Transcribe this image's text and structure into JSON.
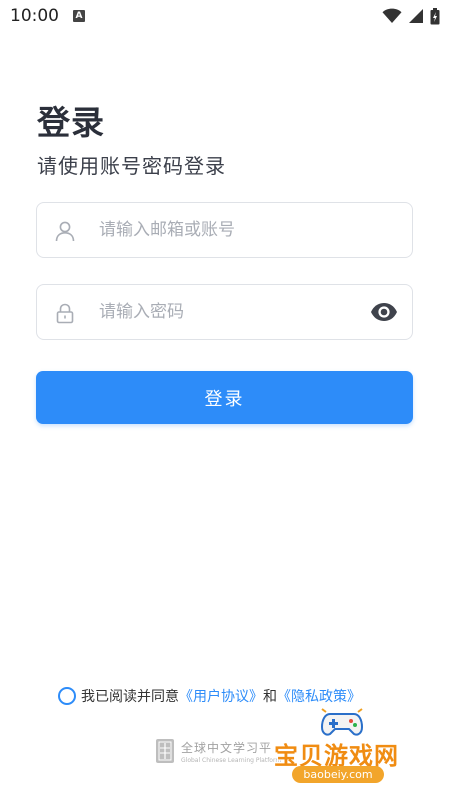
{
  "status_bar": {
    "time": "10:00",
    "notification_letter": "A"
  },
  "header": {
    "title": "登录",
    "subtitle": "请使用账号密码登录"
  },
  "form": {
    "email_placeholder": "请输入邮箱或账号",
    "email_value": "",
    "password_placeholder": "请输入密码",
    "password_value": "",
    "login_label": "登录"
  },
  "agreement": {
    "prefix": "我已阅读并同意",
    "user_agreement": "《用户协议》",
    "and": "和",
    "privacy_policy": "《隐私政策》",
    "checked": false
  },
  "brand": {
    "name_cn": "全球中文学习平",
    "name_en": "Global Chinese Learning Platform"
  },
  "watermark": {
    "name_cn": "宝贝游戏网",
    "url": "baobeiy.com"
  },
  "colors": {
    "primary": "#2d8cf9",
    "title": "#2b2f3a",
    "placeholder": "#a9adb5",
    "border": "#dfe2e7",
    "watermark": "#f08c12"
  },
  "icons": {
    "email_field": "user-icon",
    "password_field": "lock-icon",
    "password_toggle": "eye-icon"
  }
}
